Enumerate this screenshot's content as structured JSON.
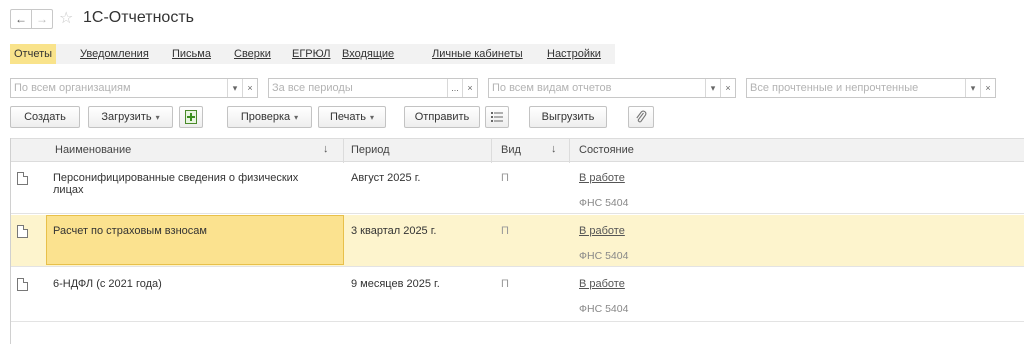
{
  "window": {
    "title": "1С-Отчетность",
    "back_label": "←",
    "forward_label": "→",
    "favorite_glyph": "☆"
  },
  "tabs": [
    {
      "label": "Отчеты",
      "active": true
    },
    {
      "label": "Уведомления",
      "active": false
    },
    {
      "label": "Письма",
      "active": false
    },
    {
      "label": "Сверки",
      "active": false
    },
    {
      "label": "ЕГРЮЛ",
      "active": false
    },
    {
      "label": "Входящие",
      "active": false
    },
    {
      "label": "Личные кабинеты",
      "active": false
    },
    {
      "label": "Настройки",
      "active": false
    }
  ],
  "filters": {
    "organization": {
      "placeholder": "По всем организациям",
      "dropdown_glyph": "▾",
      "clear_glyph": "×"
    },
    "period": {
      "placeholder": "За все периоды",
      "choose_glyph": "...",
      "clear_glyph": "×"
    },
    "report_type": {
      "placeholder": "По всем видам отчетов",
      "dropdown_glyph": "▾",
      "clear_glyph": "×"
    },
    "read_state": {
      "placeholder": "Все прочтенные и непрочтенные",
      "dropdown_glyph": "▾",
      "clear_glyph": "×"
    }
  },
  "toolbar": {
    "create": "Создать",
    "load": "Загрузить",
    "check": "Проверка",
    "print": "Печать",
    "send": "Отправить",
    "export": "Выгрузить",
    "caret": "▾"
  },
  "table": {
    "columns": {
      "name": "Наименование",
      "period": "Период",
      "kind": "Вид",
      "state": "Состояние",
      "sort_glyph": "↓"
    },
    "rows": [
      {
        "name_line1": "Персонифицированные сведения о физических",
        "name_line2": "лицах",
        "period": "Август 2025 г.",
        "kind": "П",
        "state": "В работе",
        "recipient": "ФНС 5404",
        "selected": false
      },
      {
        "name_line1": "Расчет по страховым взносам",
        "name_line2": "",
        "period": "3 квартал 2025 г.",
        "kind": "П",
        "state": "В работе",
        "recipient": "ФНС 5404",
        "selected": true
      },
      {
        "name_line1": "6-НДФЛ (с 2021 года)",
        "name_line2": "",
        "period": "9 месяцев 2025 г.",
        "kind": "П",
        "state": "В работе",
        "recipient": "ФНС 5404",
        "selected": false
      }
    ]
  }
}
